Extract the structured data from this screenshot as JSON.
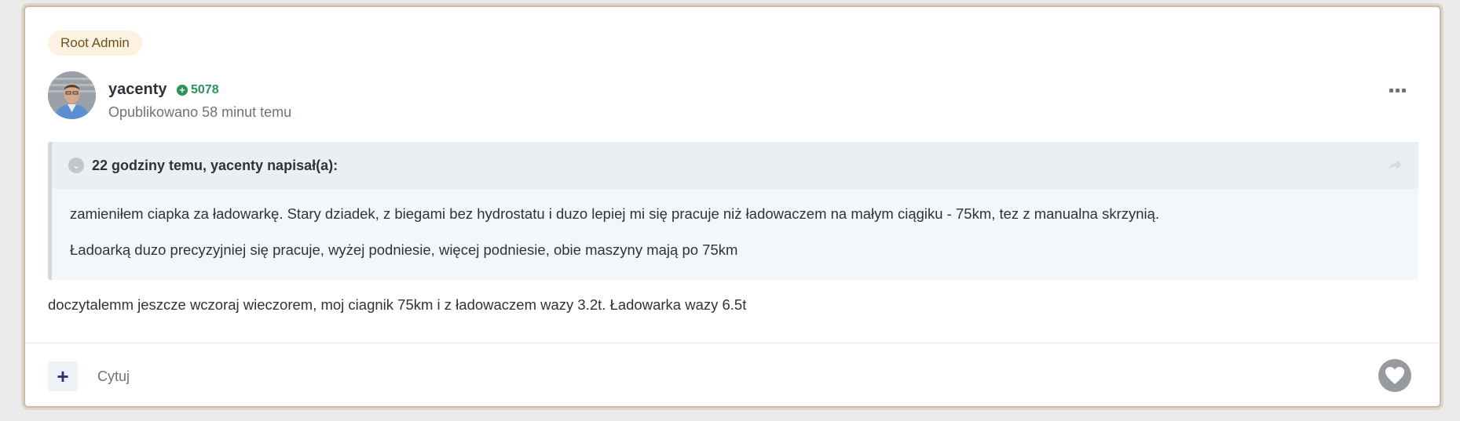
{
  "post": {
    "role_badge": "Root Admin",
    "author": {
      "name": "yacenty",
      "reputation": "5078",
      "reputation_icon": "plus-circle-icon"
    },
    "published": "Opublikowano 58 minut temu",
    "quote": {
      "citation": "22 godziny temu, yacenty napisał(a):",
      "paragraphs": [
        "zamieniłem ciapka za ładowarkę. Stary dziadek, z biegami bez hydrostatu i duzo lepiej mi się pracuje niż ładowaczem na małym ciągiku - 75km, tez z manualna skrzynią.",
        "Ładoarką duzo precyzyjniej się pracuje, wyżej podniesie, więcej podniesie, obie maszyny mają po 75km"
      ]
    },
    "content": "doczytalemm jeszcze wczoraj wieczorem, moj ciagnik 75km i z ładowaczem wazy 3.2t. Ładowarka wazy 6.5t",
    "footer": {
      "multiquote_icon": "plus-icon",
      "quote_label": "Cytuj",
      "like_icon": "heart-icon"
    }
  },
  "colors": {
    "border": "#c9bca4",
    "badge_bg": "#fcf2e1",
    "reputation": "#2a9459",
    "multiquote": "#3a2c6e"
  }
}
